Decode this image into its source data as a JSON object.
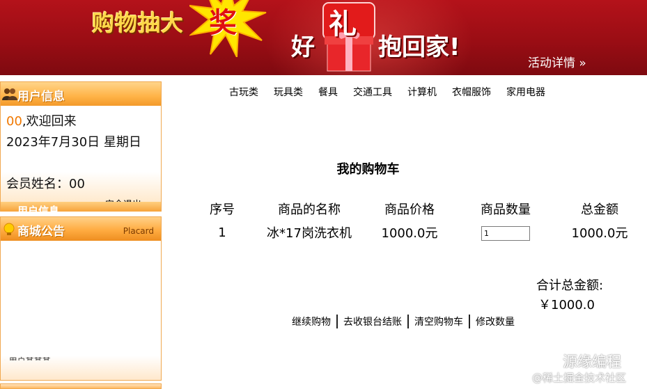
{
  "banner": {
    "headline_left": "购物抽大",
    "headline_burst_char": "奖",
    "headline_right_a": "好",
    "headline_gift_char": "礼",
    "headline_right_b": "抱回家!",
    "detail_link": "活动详情 »",
    "colors": {
      "background": "#a30f17",
      "headline": "#ffd84a",
      "burst": "#ffe600"
    }
  },
  "user_panel": {
    "title": "用户信息",
    "icon": "users-icon",
    "username": "00",
    "welcome_suffix": ",欢迎回来",
    "date_line": "2023年7月30日 星期日",
    "member_label": "会员姓名：",
    "member_name": "00",
    "logout_label": "安全退出"
  },
  "ghost_panel": {
    "title": "用户信息"
  },
  "notice_panel": {
    "title": "商城公告",
    "subtitle": "Placard",
    "icon": "bulb-icon",
    "item_partial": "· 用户某某某"
  },
  "nav": {
    "categories": [
      "古玩类",
      "玩具类",
      "餐具",
      "交通工具",
      "计算机",
      "衣帽服饰",
      "家用电器"
    ]
  },
  "cart": {
    "title": "我的购物车",
    "columns": [
      "序号",
      "商品的名称",
      "商品价格",
      "商品数量",
      "总金额"
    ],
    "rows": [
      {
        "index": "1",
        "name": "冰*17岗洗衣机",
        "price": "1000.0元",
        "quantity": "1",
        "total": "1000.0元"
      }
    ],
    "total_label": "合计总金额:",
    "total_value": "￥1000.0"
  },
  "actions": [
    "继续购物",
    "去收银台结账",
    "清空购物车",
    "修改数量"
  ],
  "watermark": {
    "line1": "源缘编程",
    "line2": "@稀土掘金技术社区",
    "icon": "wechat-icon"
  }
}
